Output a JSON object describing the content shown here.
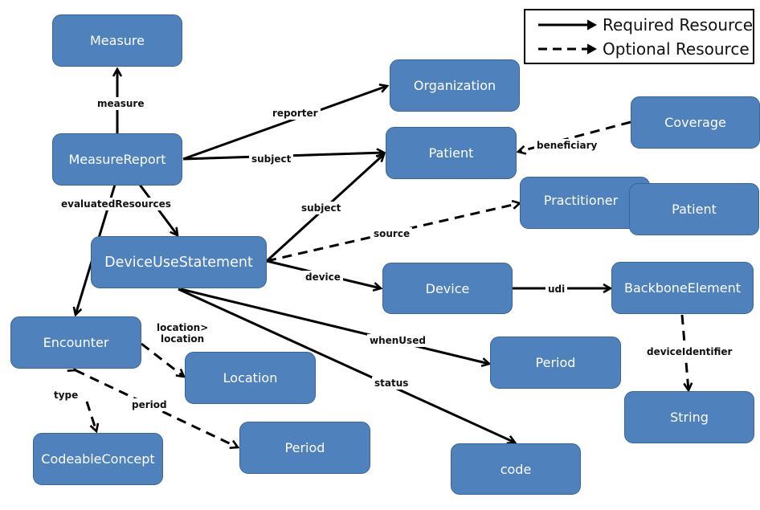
{
  "diagram": {
    "legend": {
      "required_label": "Required Resource",
      "optional_label": "Optional Resource"
    },
    "nodes": {
      "measure": "Measure",
      "measure_report": "MeasureReport",
      "organization": "Organization",
      "patient_top": "Patient",
      "coverage": "Coverage",
      "practitioner": "Practitioner",
      "patient_source": "Patient",
      "device_use_statement": "DeviceUseStatement",
      "device": "Device",
      "backbone_element": "BackboneElement",
      "encounter": "Encounter",
      "location": "Location",
      "period_when_used": "Period",
      "string": "String",
      "codeable_concept": "CodeableConcept",
      "period_encounter": "Period",
      "code": "code"
    },
    "edges": [
      {
        "id": "measure",
        "label": "measure",
        "from": "MeasureReport",
        "to": "Measure",
        "style": "required"
      },
      {
        "id": "reporter",
        "label": "reporter",
        "from": "MeasureReport",
        "to": "Organization",
        "style": "required"
      },
      {
        "id": "subject_mr",
        "label": "subject",
        "from": "MeasureReport",
        "to": "Patient",
        "style": "required"
      },
      {
        "id": "evaluated",
        "label": "evaluatedResources",
        "from": "MeasureReport",
        "to": "DeviceUseStatement / Encounter",
        "style": "required"
      },
      {
        "id": "beneficiary",
        "label": "beneficiary",
        "from": "Coverage",
        "to": "Patient",
        "style": "optional"
      },
      {
        "id": "subject_dus",
        "label": "subject",
        "from": "DeviceUseStatement",
        "to": "Patient",
        "style": "required"
      },
      {
        "id": "source",
        "label": "source",
        "from": "DeviceUseStatement",
        "to": "Practitioner / Patient",
        "style": "optional"
      },
      {
        "id": "device",
        "label": "device",
        "from": "DeviceUseStatement",
        "to": "Device",
        "style": "required"
      },
      {
        "id": "udi",
        "label": "udi",
        "from": "Device",
        "to": "BackboneElement",
        "style": "required"
      },
      {
        "id": "device_identifier",
        "label": "deviceIdentifier",
        "from": "BackboneElement",
        "to": "String",
        "style": "optional"
      },
      {
        "id": "when_used",
        "label": "whenUsed",
        "from": "DeviceUseStatement",
        "to": "Period",
        "style": "required"
      },
      {
        "id": "status",
        "label": "status",
        "from": "DeviceUseStatement",
        "to": "code",
        "style": "required"
      },
      {
        "id": "location",
        "label": "location>\nlocation",
        "from": "Encounter",
        "to": "Location",
        "style": "optional"
      },
      {
        "id": "type",
        "label": "type",
        "from": "Encounter",
        "to": "CodeableConcept",
        "style": "optional"
      },
      {
        "id": "period",
        "label": "period",
        "from": "Encounter",
        "to": "Period",
        "style": "optional"
      }
    ],
    "colors": {
      "node_fill": "#4f81bd",
      "node_border": "#3a6595",
      "node_text": "#ffffff",
      "edge": "#000000"
    }
  }
}
